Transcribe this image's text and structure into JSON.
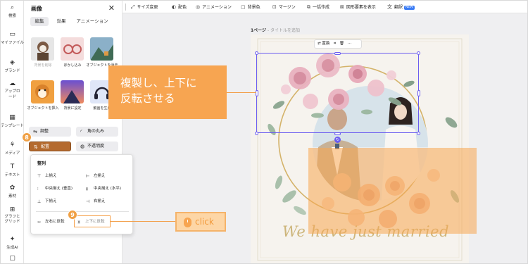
{
  "rail": {
    "items": [
      {
        "label": "検索",
        "icon": "search-icon"
      },
      {
        "label": "マイファイル",
        "icon": "folder-icon"
      },
      {
        "label": "ブランド",
        "icon": "brand-icon"
      },
      {
        "label": "アップロード",
        "icon": "upload-icon"
      },
      {
        "label": "テンプレート",
        "icon": "template-icon"
      },
      {
        "label": "メディア",
        "icon": "media-icon"
      },
      {
        "label": "テキスト",
        "icon": "text-icon"
      },
      {
        "label": "素材",
        "icon": "elements-icon"
      },
      {
        "label": "グラフとグリッド",
        "icon": "chart-grid-icon"
      },
      {
        "label": "生成AI",
        "icon": "ai-icon"
      }
    ]
  },
  "panel": {
    "title": "画像",
    "tabs": [
      "編集",
      "効果",
      "アニメーション"
    ],
    "tools": [
      {
        "label": "背景を削除"
      },
      {
        "label": "ぼかし込み"
      },
      {
        "label": "オブジェクトを消去"
      },
      {
        "label": "オブジェクトを挿入"
      },
      {
        "label": "背景に設定"
      },
      {
        "label": "動画を生成"
      }
    ],
    "buttons": {
      "adjust": "調整",
      "corner": "角の丸み",
      "arrange": "配置",
      "opacity": "不透明度"
    }
  },
  "popup": {
    "title": "整列",
    "items": {
      "top": "上揃え",
      "left": "左揃え",
      "middle_v": "中央揃え (垂直)",
      "middle_h": "中央揃え (水平)",
      "bottom": "下揃え",
      "right": "右揃え",
      "flip_h": "左右に反転",
      "flip_v": "上下に反転"
    }
  },
  "steps": {
    "step8": "8",
    "step9": "9"
  },
  "toolbar": {
    "items": [
      {
        "label": "サイズ変更",
        "icon": "resize-icon"
      },
      {
        "label": "配色",
        "icon": "palette-icon"
      },
      {
        "label": "アニメーション",
        "icon": "animation-icon"
      },
      {
        "label": "背景色",
        "icon": "background-icon"
      },
      {
        "label": "マージン",
        "icon": "margin-icon"
      },
      {
        "label": "一括作成",
        "icon": "batch-icon"
      },
      {
        "label": "図形要素を表示",
        "icon": "shapes-icon"
      },
      {
        "label": "翻訳",
        "icon": "translate-icon"
      }
    ],
    "new_badge": "NEW"
  },
  "canvas": {
    "page_label": "1ページ",
    "page_title_placeholder": " - タイトルを追加",
    "selection_toolbar": {
      "replace": "置換"
    },
    "script_text": "We have just married"
  },
  "callout": {
    "text_line1": "複製し、上下に",
    "text_line2": "反転させる",
    "click_label": "click"
  },
  "colors": {
    "accent_orange": "#f7a551",
    "selection_purple": "#6b5cf0",
    "page_bg": "#f6f3ee",
    "script_gold": "#cdb57a"
  }
}
